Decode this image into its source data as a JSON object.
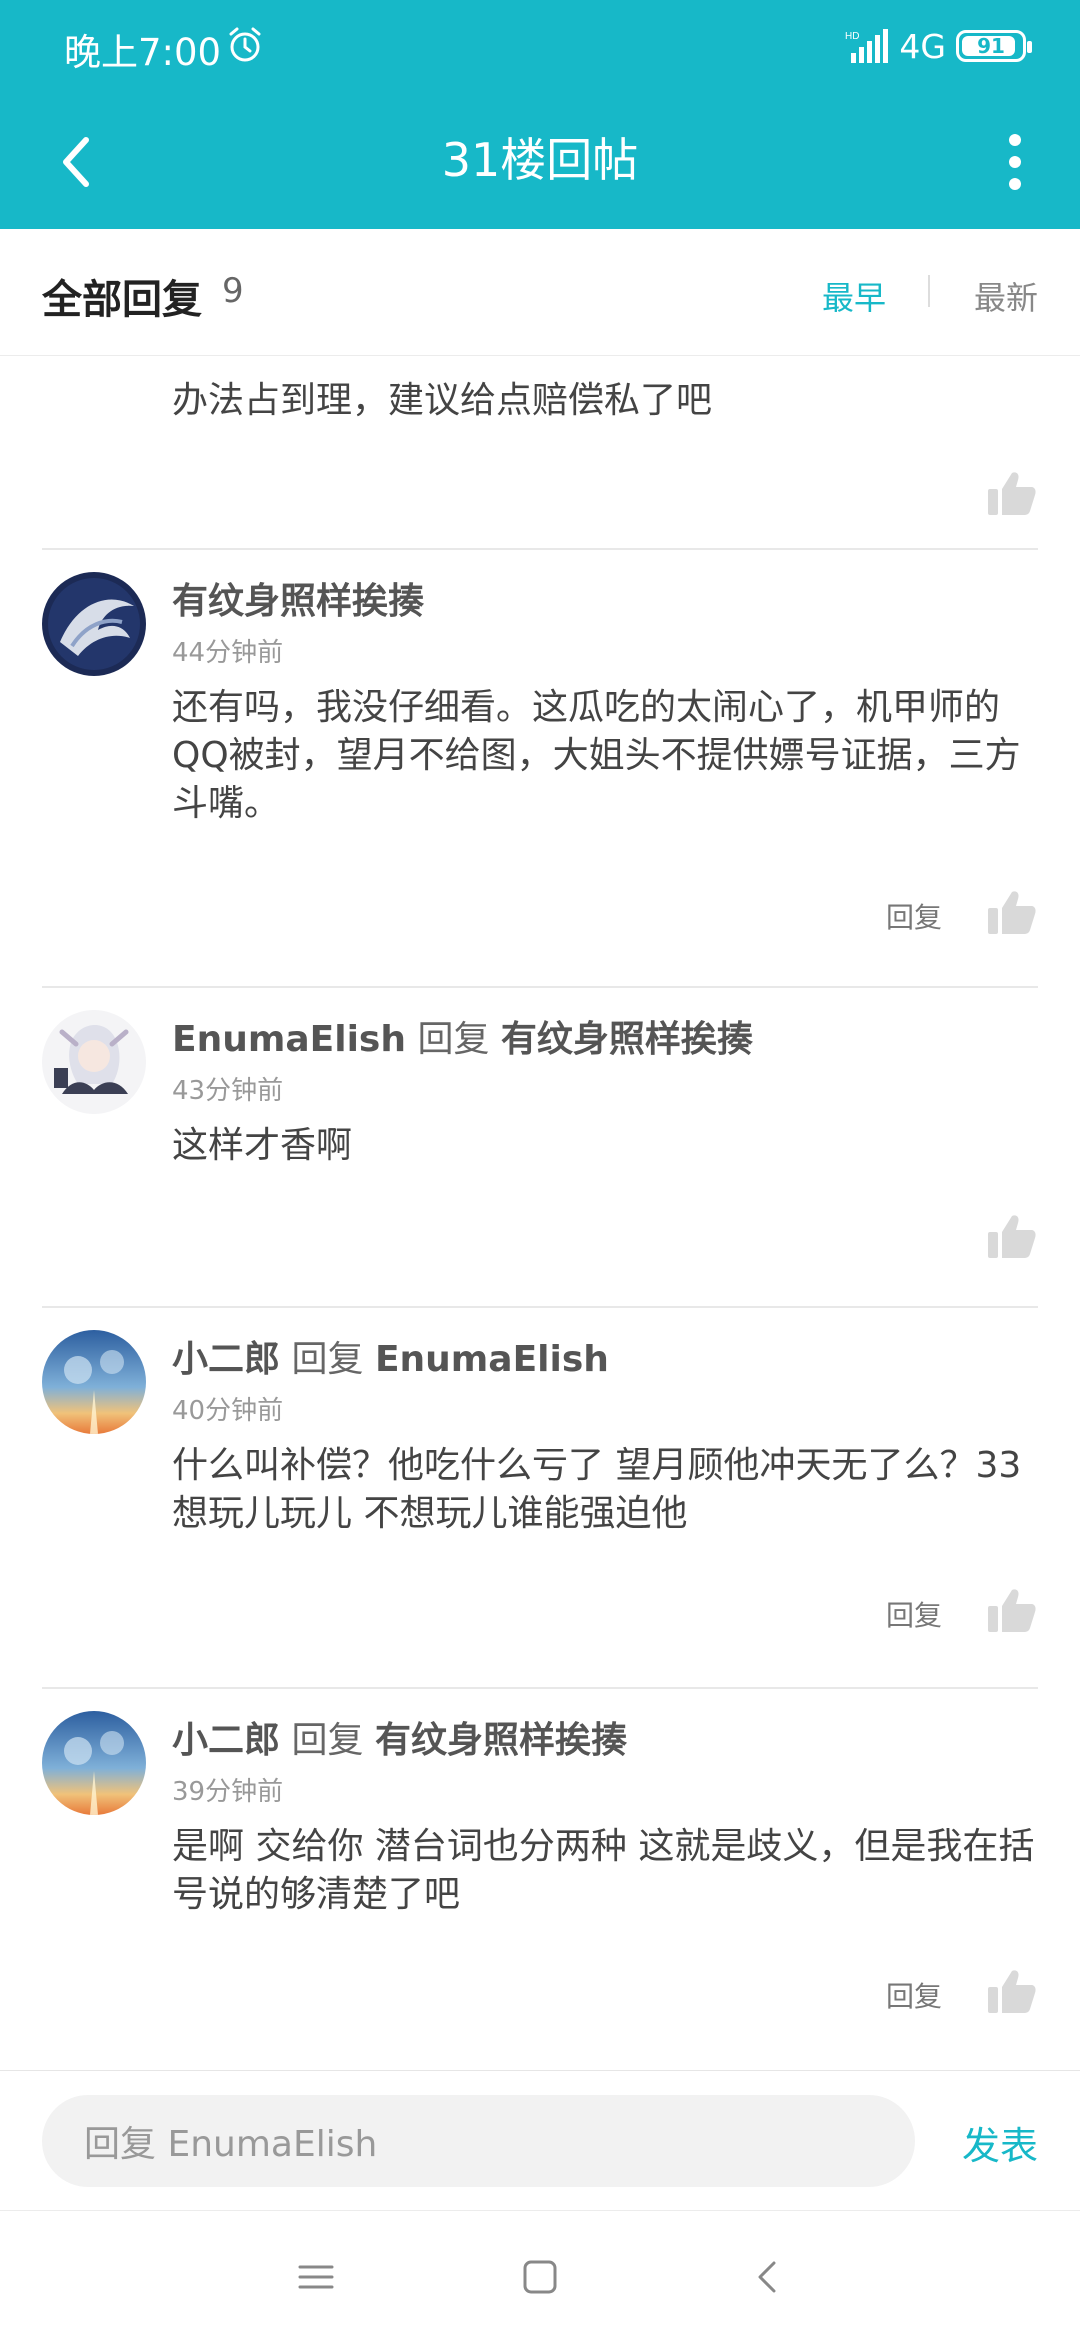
{
  "status_bar": {
    "time": "晚上7:00",
    "network": "4G",
    "battery": "91",
    "battery_level": 0.91
  },
  "header": {
    "title": "31楼回帖"
  },
  "sort_bar": {
    "label": "全部回复",
    "count": "9",
    "earliest": "最早",
    "newest": "最新"
  },
  "comments": [
    {
      "content": "办法占到理，建议给点赔偿私了吧"
    },
    {
      "author": "有纹身照样挨揍",
      "time": "44分钟前",
      "content": "还有吗，我没仔细看。这瓜吃的太闹心了，机甲师的QQ被封，望月不给图，大姐头不提供嫖号证据，三方斗嘴。",
      "reply_label": "回复"
    },
    {
      "author": "EnumaElish",
      "reply_word": "回复",
      "reply_to": "有纹身照样挨揍",
      "time": "43分钟前",
      "content": "这样才香啊"
    },
    {
      "author": "小二郎",
      "reply_word": "回复",
      "reply_to": "EnumaElish",
      "time": "40分钟前",
      "content": "什么叫补偿？他吃什么亏了 望月顾他冲天无了么？33想玩儿玩儿 不想玩儿谁能强迫他",
      "reply_label": "回复"
    },
    {
      "author": "小二郎",
      "reply_word": "回复",
      "reply_to": "有纹身照样挨揍",
      "time": "39分钟前",
      "content": "是啊 交给你 潜台词也分两种 这就是歧义，但是我在括号说的够清楚了吧",
      "reply_label": "回复"
    }
  ],
  "input_bar": {
    "placeholder": "回复 EnumaElish",
    "send_label": "发表"
  },
  "colors": {
    "accent": "#17b8c8",
    "like_icon": "#d9d9d9"
  }
}
